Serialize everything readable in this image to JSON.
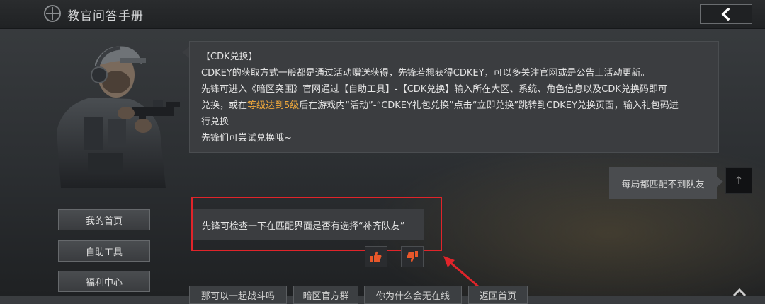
{
  "header": {
    "title": "教官问答手册"
  },
  "menu": {
    "items": [
      {
        "label": "我的首页"
      },
      {
        "label": "自助工具"
      },
      {
        "label": "福利中心"
      }
    ]
  },
  "chat": {
    "bot_message": {
      "lines": [
        "【CDK兑换】",
        "CDKEY的获取方式一般都是通过活动赠送获得，先锋若想获得CDKEY，可以多关注官网或是公告上活动更新。",
        "先锋可进入《暗区突围》官网通过【自助工具】-【CDK兑换】输入所在大区、系统、角色信息以及CDK兑换码即可",
        "先锋们可尝试兑换哦~"
      ],
      "line4_pre": "兑换，或在",
      "line4_highlight": "等级达到5级",
      "line4_post": "后在游戏内“活动”-“CDKEY礼包兑换”点击“立即兑换”跳转到CDKEY兑换页面，输入礼包码进",
      "line5": "行兑换"
    },
    "user_message": "每局都匹配不到队友",
    "bot_answer": "先锋可检查一下在匹配界面是否有选择“补齐队友”"
  },
  "quick_questions": [
    {
      "label": "那可以一起战斗吗"
    },
    {
      "label": "暗区官方群"
    },
    {
      "label": "你为什么会无在线"
    },
    {
      "label": "返回首页"
    }
  ],
  "colors": {
    "highlight_text": "#f0a93c",
    "annotation_red": "#e0242a",
    "thumb_orange": "#e8572a"
  },
  "icons": {
    "back": "chevron-left",
    "like": "thumbs-up",
    "dislike": "thumbs-down",
    "scroll": "chevron-up"
  }
}
